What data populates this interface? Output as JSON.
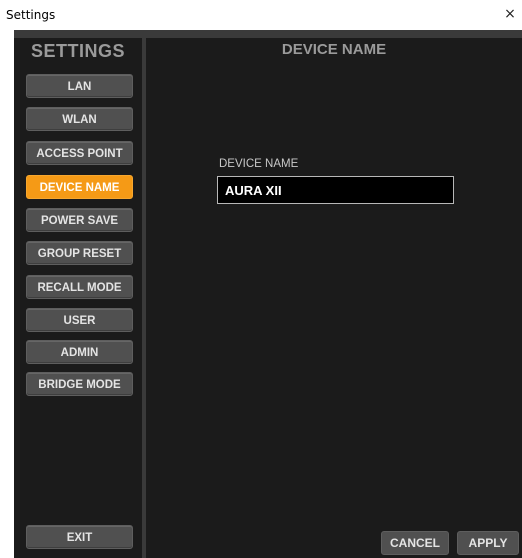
{
  "window": {
    "title": "Settings",
    "close_glyph": "×"
  },
  "sidebar": {
    "title": "SETTINGS",
    "items": [
      {
        "label": "LAN",
        "active": false
      },
      {
        "label": "WLAN",
        "active": false
      },
      {
        "label": "ACCESS POINT",
        "active": false
      },
      {
        "label": "DEVICE NAME",
        "active": true
      },
      {
        "label": "POWER SAVE",
        "active": false
      },
      {
        "label": "GROUP RESET",
        "active": false
      },
      {
        "label": "RECALL MODE",
        "active": false
      },
      {
        "label": "USER",
        "active": false
      },
      {
        "label": "ADMIN",
        "active": false
      },
      {
        "label": "BRIDGE MODE",
        "active": false
      }
    ],
    "exit_label": "EXIT"
  },
  "main": {
    "title": "DEVICE NAME",
    "field_label": "DEVICE NAME",
    "field_value": "AURA XII",
    "cancel_label": "CANCEL",
    "apply_label": "APPLY"
  },
  "colors": {
    "accent": "#f59a16",
    "panel": "#1b1b1b",
    "button": "#505050"
  },
  "icons": {
    "close": "close-icon"
  }
}
